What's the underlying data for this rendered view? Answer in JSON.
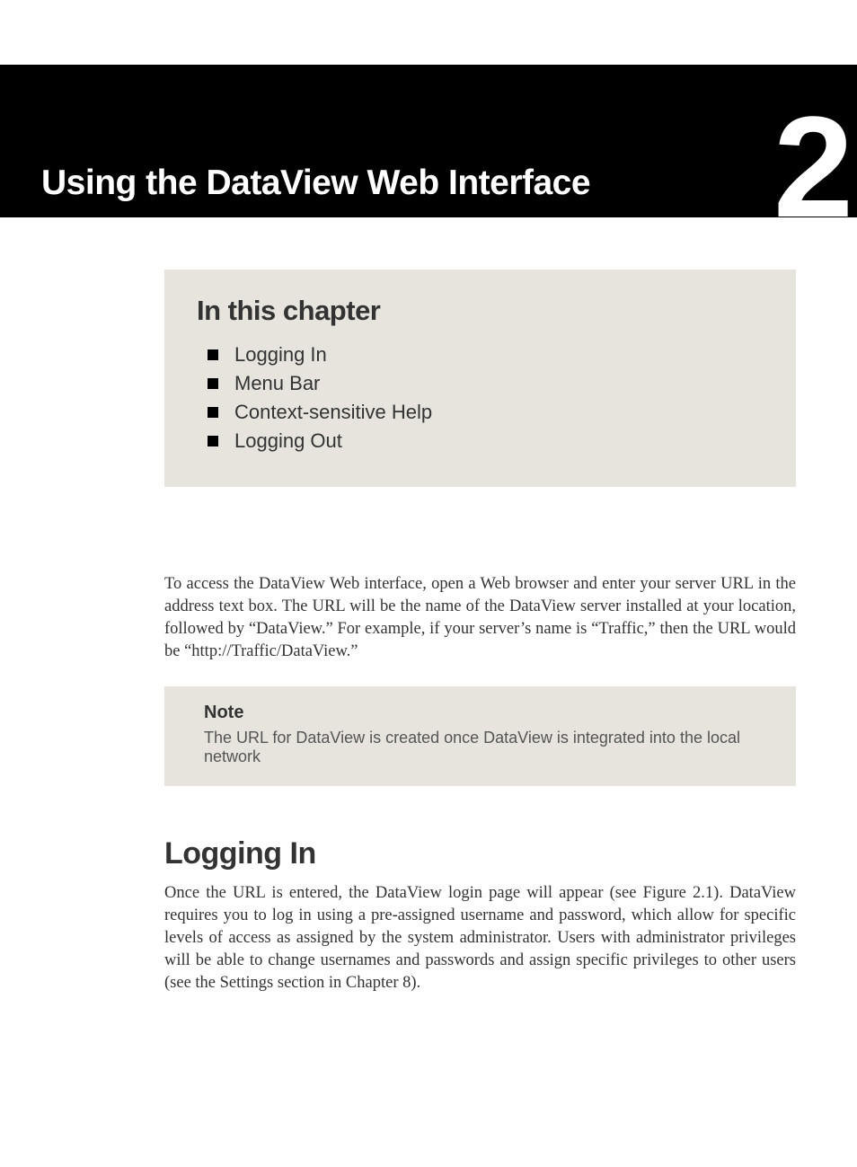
{
  "chapter": {
    "number": "2",
    "title": "Using the DataView Web Interface"
  },
  "toc": {
    "heading": "In this chapter",
    "items": [
      "Logging In",
      "Menu Bar",
      "Context-sensitive Help",
      "Logging Out"
    ]
  },
  "intro_paragraph": "To access the DataView Web interface, open a Web browser and enter your server URL in the address text box. The URL will be the name of the DataView server installed at your location, followed by “DataView.” For example, if your server’s name is “Traffic,” then the URL would be “http://Traffic/DataView.”",
  "note": {
    "heading": "Note",
    "text": "The URL for DataView is created once DataView is integrated into the local network"
  },
  "section": {
    "heading": "Logging In",
    "paragraph": "Once the URL is entered, the DataView login page will appear (see Figure 2.1). DataView requires you to log in using a pre-assigned username and password, which allow for specific levels of access as assigned by the system administrator. Users with administrator privileges will be able to change usernames and passwords and assign specific privileges to other users (see the Settings section in Chapter 8)."
  }
}
